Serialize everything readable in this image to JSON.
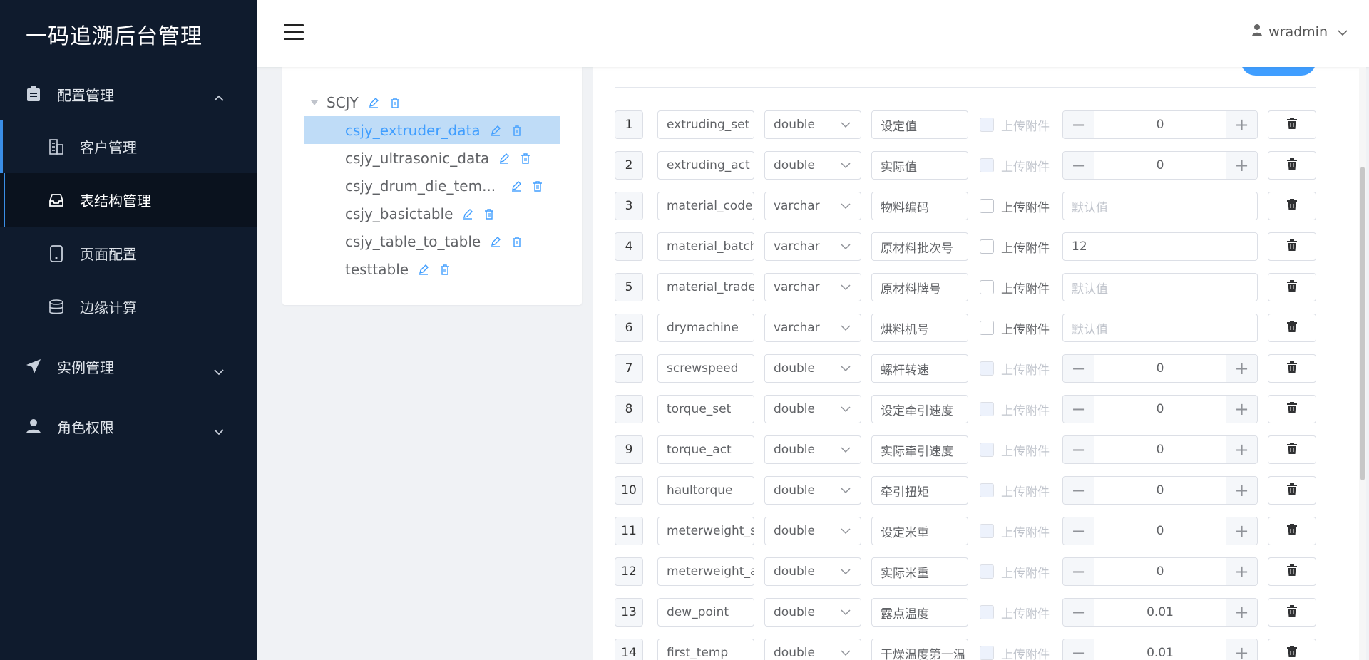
{
  "brand": {
    "title": "一码追溯后台管理"
  },
  "sidebar": {
    "groups": [
      {
        "label": "配置管理",
        "icon": "clipboard-icon",
        "expanded": true
      },
      {
        "label": "实例管理",
        "icon": "paper-plane-icon",
        "expanded": false
      },
      {
        "label": "角色权限",
        "icon": "user-icon",
        "expanded": false
      }
    ],
    "sub_items": [
      {
        "label": "客户管理",
        "icon": "building-icon"
      },
      {
        "label": "表结构管理",
        "icon": "inbox-icon"
      },
      {
        "label": "页面配置",
        "icon": "mobile-icon"
      },
      {
        "label": "边缘计算",
        "icon": "database-icon"
      }
    ]
  },
  "header": {
    "username": "wradmin"
  },
  "tree": {
    "root": "SCJY",
    "nodes": [
      {
        "label": "csjy_extruder_data",
        "selected": true
      },
      {
        "label": "csjy_ultrasonic_data"
      },
      {
        "label": "csjy_drum_die_tem..."
      },
      {
        "label": "csjy_basictable"
      },
      {
        "label": "csjy_table_to_table"
      },
      {
        "label": "testtable"
      }
    ]
  },
  "fields": {
    "upload_label": "上传附件",
    "default_placeholder": "默认值",
    "rows": [
      {
        "idx": "1",
        "name": "extruding_set",
        "type": "double",
        "desc": "设定值",
        "value": "0"
      },
      {
        "idx": "2",
        "name": "extruding_act",
        "type": "double",
        "desc": "实际值",
        "value": "0"
      },
      {
        "idx": "3",
        "name": "material_code",
        "type": "varchar",
        "desc": "物料编码",
        "value": ""
      },
      {
        "idx": "4",
        "name": "material_batch",
        "type": "varchar",
        "desc": "原材料批次号",
        "value": "12"
      },
      {
        "idx": "5",
        "name": "material_traden",
        "type": "varchar",
        "desc": "原材料牌号",
        "value": ""
      },
      {
        "idx": "6",
        "name": "drymachine",
        "type": "varchar",
        "desc": "烘料机号",
        "value": ""
      },
      {
        "idx": "7",
        "name": "screwspeed",
        "type": "double",
        "desc": "螺杆转速",
        "value": "0"
      },
      {
        "idx": "8",
        "name": "torque_set",
        "type": "double",
        "desc": "设定牵引速度",
        "value": "0"
      },
      {
        "idx": "9",
        "name": "torque_act",
        "type": "double",
        "desc": "实际牵引速度",
        "value": "0"
      },
      {
        "idx": "10",
        "name": "haultorque",
        "type": "double",
        "desc": "牵引扭矩",
        "value": "0"
      },
      {
        "idx": "11",
        "name": "meterweight_se",
        "type": "double",
        "desc": "设定米重",
        "value": "0"
      },
      {
        "idx": "12",
        "name": "meterweight_ac",
        "type": "double",
        "desc": "实际米重",
        "value": "0"
      },
      {
        "idx": "13",
        "name": "dew_point",
        "type": "double",
        "desc": "露点温度",
        "value": "0.01"
      },
      {
        "idx": "14",
        "name": "first_temp",
        "type": "double",
        "desc": "干燥温度第一温",
        "value": "0.01"
      }
    ]
  },
  "colors": {
    "sidebar_bg": "#0f1b2d",
    "accent": "#409eff",
    "selected_bg": "#bfdcf7"
  }
}
